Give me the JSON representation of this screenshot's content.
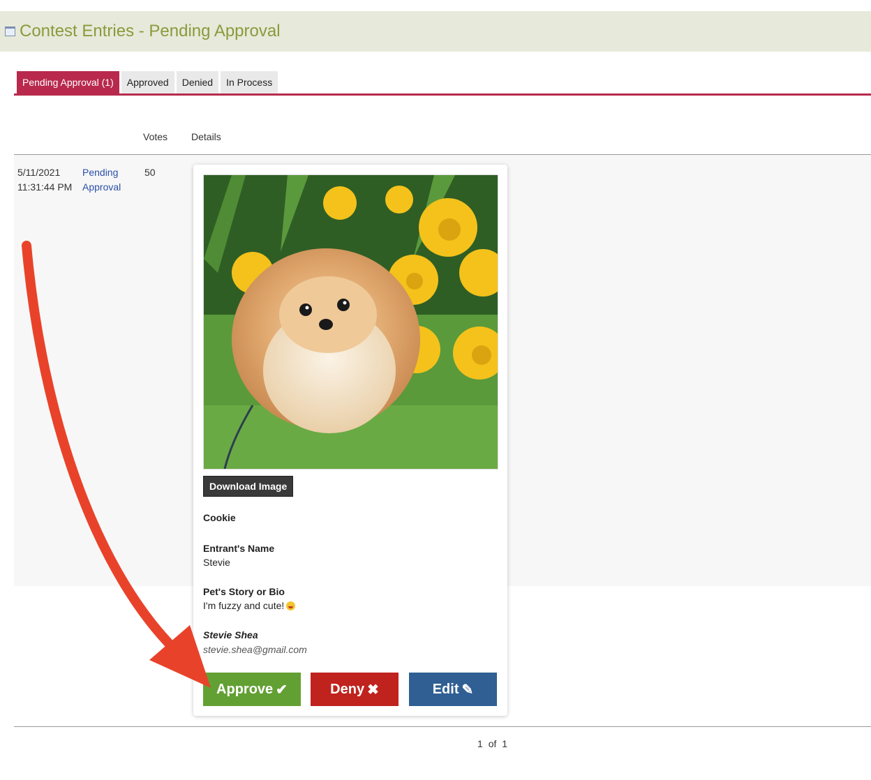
{
  "header": {
    "title": "Contest Entries - Pending Approval"
  },
  "tabs": [
    {
      "label": "Pending Approval (1)",
      "active": true
    },
    {
      "label": "Approved",
      "active": false
    },
    {
      "label": "Denied",
      "active": false
    },
    {
      "label": "In Process",
      "active": false
    }
  ],
  "columns": {
    "votes": "Votes",
    "details": "Details"
  },
  "entry": {
    "date": "5/11/2021",
    "time": "11:31:44 PM",
    "status_line1": "Pending",
    "status_line2": "Approval",
    "votes": "50",
    "download_label": "Download Image",
    "pet_name": "Cookie",
    "entrant_label": "Entrant's Name",
    "entrant_value": "Stevie",
    "story_label": "Pet's Story or Bio",
    "story_value": "I'm fuzzy and cute!",
    "contact_name": "Stevie Shea",
    "contact_email": "stevie.shea@gmail.com",
    "approve_label": "Approve",
    "deny_label": "Deny",
    "edit_label": "Edit"
  },
  "pagination": {
    "current": "1",
    "of": "of",
    "total": "1"
  },
  "colors": {
    "accent": "#b8294d",
    "title": "#8a9a3c",
    "approve": "#63a033",
    "deny": "#c0221e",
    "edit": "#2f5f93",
    "annotation_arrow": "#e8432a"
  },
  "icons": {
    "approve": "checkmark-icon",
    "deny": "x-icon",
    "edit": "pencil-icon",
    "title": "calendar-icon"
  }
}
